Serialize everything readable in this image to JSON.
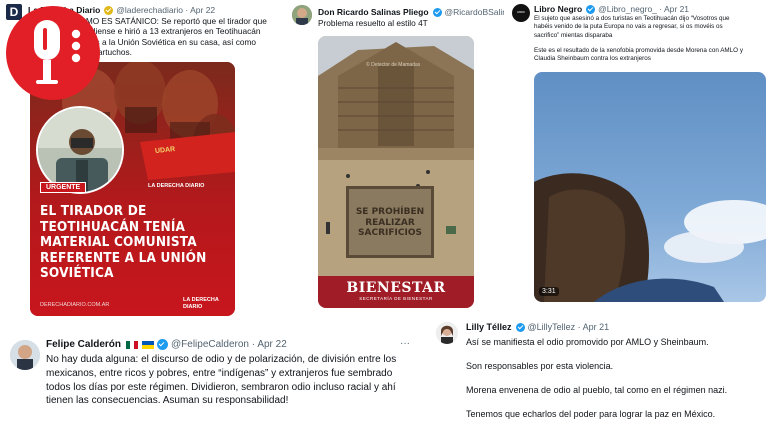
{
  "podcast_logo": {
    "icon": "microphone-icon",
    "color": "#e21f26"
  },
  "tweet1": {
    "logo_letter": "D",
    "name": "La Derecha Diario",
    "handle": "@laderechadiario · Apr 22",
    "text_lines": [
      "UNISMO ES SATÁNICO: Se reportó que el tirador que",
      "a canadiense e hirió a 13 extranjeros en Teotihuacán",
      "ferencias a la Unión Soviética en su casa, así como",
      "chillo y cartuchos."
    ],
    "poster": {
      "banner": "UDAR",
      "badge": "URGENTE",
      "headline": "EL TIRADOR DE TEOTIHUACÁN TENÍA MATERIAL COMUNISTA REFERENTE A LA UNIÓN SOVIÉTICA",
      "site": "DERECHADIARIO.COM.AR",
      "brand": "LA DERECHA DIARIO"
    }
  },
  "tweet2": {
    "name": "Don Ricardo Salinas Pliego",
    "handle": "@RicardoBSalinas · ",
    "text": "Problema resuelto al estilo 4T",
    "watermark": "© Detector de Mamadas",
    "sign_text": "SE PROHÍBEN REALIZAR SACRIFICIOS",
    "bienestar": "BIENESTAR",
    "bienestar_sub": "SECRETARÍA DE BIENESTAR"
  },
  "tweet3": {
    "logo_text": "LIBRO NEGRO",
    "name": "Libro Negro",
    "handle": "@Libro_negro_ · Apr 21",
    "text_lines": [
      "El sujeto que asesinó a dos turistas en Teotihuacán dijo “Vosotros que",
      "habéis venido de la puta Europa no vais a regresar, si os movéis os",
      "sacrifico” mientas disparaba"
    ],
    "text2_lines": [
      "Este es el resultado de la xenofobia promovida desde Morena con AMLO y",
      "Claudia Sheinbaum contra los extranjeros"
    ],
    "video_time": "3:31"
  },
  "tweet4": {
    "name": "Felipe Calderón",
    "handle": "@FelipeCalderon · Apr 22",
    "text": "No hay duda alguna: el discurso de odio y de polarización, de división entre los mexicanos, entre ricos y pobres, entre “indígenas” y extranjeros fue sembrado todos los días por este régimen. Dividieron, sembraron odio incluso racial y ahí tienen las consecuencias. Asuman su responsabilidad!"
  },
  "tweet5": {
    "name": "Lilly Téllez",
    "handle": "@LillyTellez · Apr 21",
    "paragraphs": [
      "Así se manifiesta el odio promovido por AMLO y Sheinbaum.",
      "Son responsables por esta violencia.",
      "Morena envenena de odio al pueblo, tal como en el régimen nazi.",
      "Tenemos que echarlos del poder para lograr la paz en México."
    ]
  },
  "colors": {
    "verified_blue": "#1d9bf0",
    "verified_gold": "#e2b719",
    "poster_red": "#c8161d"
  }
}
